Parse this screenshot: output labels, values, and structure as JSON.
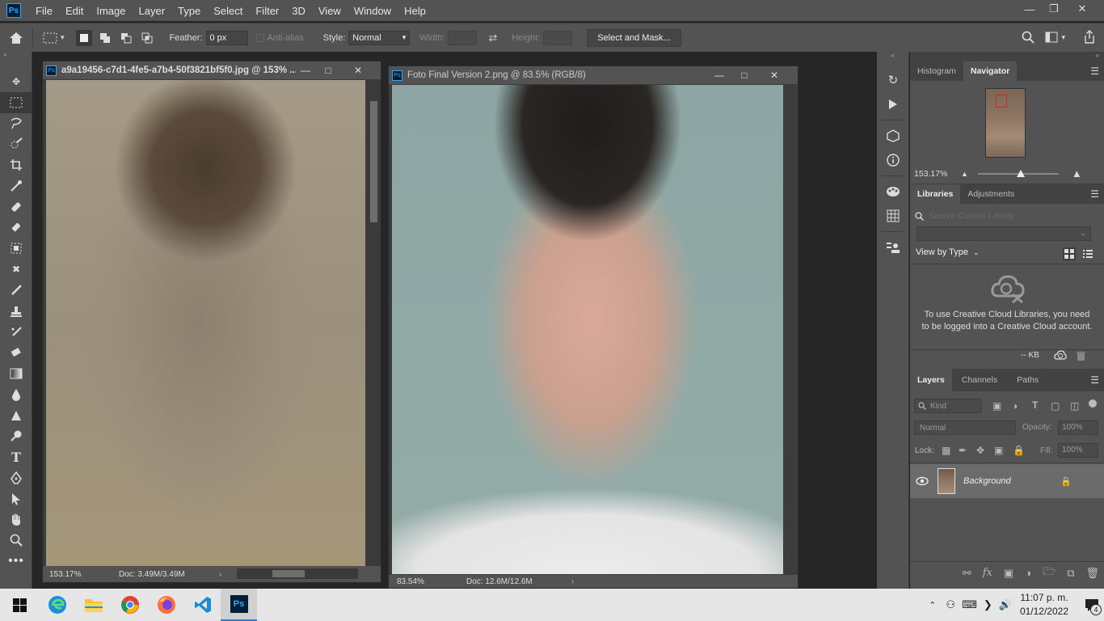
{
  "app": {
    "logo": "Ps",
    "menu": [
      "File",
      "Edit",
      "Image",
      "Layer",
      "Type",
      "Select",
      "Filter",
      "3D",
      "View",
      "Window",
      "Help"
    ]
  },
  "options": {
    "feather_label": "Feather:",
    "feather_value": "0 px",
    "antialias_label": "Anti-alias",
    "style_label": "Style:",
    "style_value": "Normal",
    "width_label": "Width:",
    "height_label": "Height:",
    "select_mask_label": "Select and Mask..."
  },
  "doc1": {
    "title": "a9a19456-c7d1-4fe5-a7b4-50f3821bf5f0.jpg @ 153% ...",
    "zoom": "153.17%",
    "doc_size": "Doc: 3.49M/3.49M"
  },
  "doc2": {
    "title": "Foto Final Version 2.png @ 83.5% (RGB/8)",
    "zoom": "83.54%",
    "doc_size": "Doc: 12.6M/12.6M"
  },
  "navigator": {
    "tabs": [
      "Histogram",
      "Navigator"
    ],
    "active_tab": "Navigator",
    "zoom": "153.17%"
  },
  "libraries": {
    "tabs": [
      "Libraries",
      "Adjustments"
    ],
    "active_tab": "Libraries",
    "search_placeholder": "Search Current Library",
    "view_by": "View by Type",
    "message": "To use Creative Cloud Libraries, you need to be logged into a Creative Cloud account.",
    "kb": "-- KB"
  },
  "layers": {
    "tabs": [
      "Layers",
      "Channels",
      "Paths"
    ],
    "active_tab": "Layers",
    "kind_label": "Kind",
    "blend_mode": "Normal",
    "opacity_label": "Opacity:",
    "opacity_value": "100%",
    "lock_label": "Lock:",
    "fill_label": "Fill:",
    "fill_value": "100%",
    "items": [
      {
        "name": "Background"
      }
    ]
  },
  "taskbar": {
    "time": "11:07 p. m.",
    "date": "01/12/2022",
    "notifications": "4",
    "ps_label": "Ps"
  }
}
